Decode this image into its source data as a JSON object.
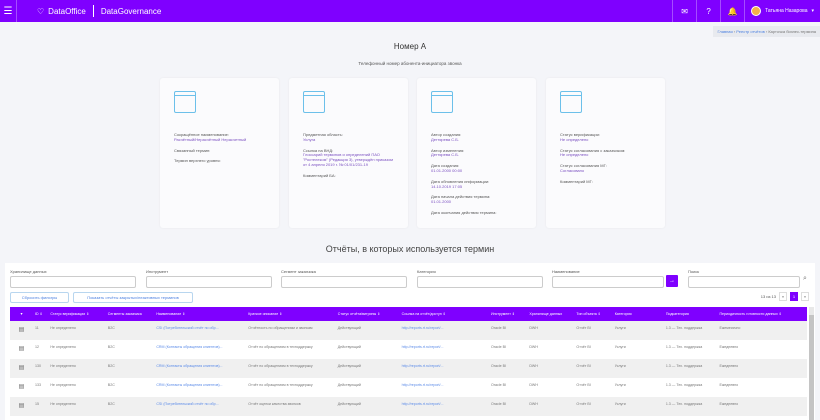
{
  "header": {
    "brand": "DataOffice",
    "product": "DataGovernance",
    "user": "Татьяна Назарова"
  },
  "breadcrumb": [
    "Главная",
    "Реестр отчётов",
    "Карточка бизнес-термина"
  ],
  "page": {
    "title": "Номер А",
    "subtitle": "Телефонный номер абонента-инициатора звонка"
  },
  "cards": [
    {
      "icon": "edit-window-icon",
      "fields": [
        {
          "label": "Сокращённое наименование:",
          "value": "Расчётный/Нерасчётный Нерасчетный"
        },
        {
          "label": "Связанный термин:",
          "value": ""
        },
        {
          "label": "Термин верхнего уровня:",
          "value": ""
        }
      ]
    },
    {
      "icon": "layout-window-icon",
      "fields": [
        {
          "label": "Предметная область:",
          "value": "Услуга"
        },
        {
          "label": "Ссылка на ВНД:",
          "value": "Глоссарий терминов и определений ПАО \"Ростелеком\" (Редакция 3), утверждён приказом от 4 апреля 2019 г. № 01/01/231-19"
        },
        {
          "label": "Комментарий БА:",
          "value": ""
        }
      ]
    },
    {
      "icon": "hierarchy-window-icon",
      "fields": [
        {
          "label": "Автор создания:",
          "value": "Дегтярева С.Б."
        },
        {
          "label": "Автор изменения:",
          "value": "Дегтярева С.Б."
        },
        {
          "label": "Дата создания:",
          "value": "01.01.2000 00:00"
        },
        {
          "label": "Дата обновления информации:",
          "value": "14.10.2019 17:05"
        },
        {
          "label": "Дата начала действия термина:",
          "value": "01.01.2000"
        },
        {
          "label": "Дата окончания действия термина:",
          "value": ""
        }
      ]
    },
    {
      "icon": "download-window-icon",
      "fields": [
        {
          "label": "Статус верификации:",
          "value": "Не определено"
        },
        {
          "label": "Статус согласования с заказчиком:",
          "value": "Не определено"
        },
        {
          "label": "Статус согласования МГ:",
          "value": "Согласовано"
        },
        {
          "label": "Комментарий МГ:",
          "value": ""
        }
      ]
    }
  ],
  "reports": {
    "title": "Отчёты, в которых используется термин",
    "filters": [
      {
        "label": "Хранилище данных",
        "value": ""
      },
      {
        "label": "Инструмент",
        "value": ""
      },
      {
        "label": "Сегмент заказчика",
        "value": ""
      },
      {
        "label": "Категория",
        "value": ""
      },
      {
        "label": "Наименование",
        "value": ""
      },
      {
        "label": "Поиск",
        "value": ""
      }
    ],
    "go_label": "→",
    "reset_label": "Сбросить фильтры",
    "show_closed_label": "Показать отчёты закрытых/неактивных терминов",
    "pagination": {
      "summary": "13 из 13",
      "prev": "«",
      "current": "1",
      "next": "»"
    },
    "columns": [
      "ID ⇕",
      "Статус верификации ⇕",
      "Сегменты заказчика",
      "Наименование ⇕",
      "Краткое описание ⇕",
      "Статус отчёта/витрины ⇕",
      "Ссылка на отчёт/доступ ⇕",
      "Инструмент ⇕",
      "Хранилище данных",
      "Тип объекта ⇕",
      "Категория",
      "Подкатегория",
      "Периодичность готовности данных ⇕"
    ],
    "rows": [
      [
        "11",
        "Не определено",
        "B2C",
        "CSI (Потребительский отчёт по обр...",
        "Отчётность по обращениям и звонкам",
        "Действующий",
        "http://reports.rt.ru/report/...",
        "Oracle BI",
        "DWH",
        "Отчёт BI",
        "Услуги",
        "1.3 — Тех. поддержка",
        "Ежемесячно"
      ],
      [
        "12",
        "Не определено",
        "B2C",
        "CRM (Контакты обращения клиентов)...",
        "Отчёт по обращениям в техподдержку",
        "Действующий",
        "http://reports.rt.ru/report/...",
        "Oracle BI",
        "DWH",
        "Отчёт BI",
        "Услуги",
        "1.3 — Тех. поддержка",
        "Ежедневно"
      ],
      [
        "130",
        "Не определено",
        "B2C",
        "CRM (Контакты обращения клиентов)...",
        "Отчёт по обращениям в техподдержку",
        "Действующий",
        "http://reports.rt.ru/report/...",
        "Oracle BI",
        "DWH",
        "Отчёт BI",
        "Услуги",
        "1.3 — Тех. поддержка",
        "Ежедневно"
      ],
      [
        "133",
        "Не определено",
        "B2C",
        "CRM (Контакты обращения клиентов)...",
        "Отчёт по обращениям в техподдержку",
        "Действующий",
        "http://reports.rt.ru/report/...",
        "Oracle BI",
        "DWH",
        "Отчёт BI",
        "Услуги",
        "1.3 — Тех. поддержка",
        "Ежедневно"
      ],
      [
        "15",
        "Не определено",
        "B2C",
        "CSI (Потребительский отчёт по обр...",
        "Отчёт оценки качества звонков",
        "Действующий",
        "http://reports.rt.ru/report/...",
        "Oracle BI",
        "DWH",
        "Отчёт BI",
        "Услуги",
        "1.3 — Тех. поддержка",
        "Ежедневно"
      ]
    ]
  }
}
